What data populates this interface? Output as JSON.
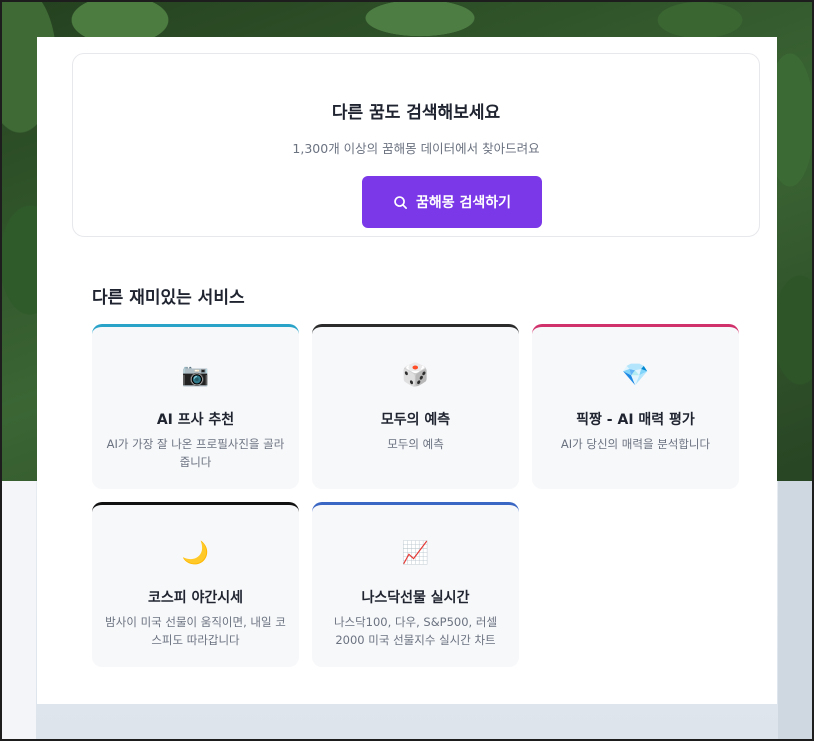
{
  "search_section": {
    "title": "다른 꿈도 검색해보세요",
    "subtitle": "1,300개 이상의 꿈해몽 데이터에서 찾아드려요",
    "button_label": "꿈해몽 검색하기",
    "button_color": "#7a38e8"
  },
  "services_section": {
    "title": "다른 재미있는 서비스",
    "cards": [
      {
        "icon": "📷",
        "icon_name": "camera-icon",
        "title": "AI 프사 추천",
        "desc": "AI가 가장 잘 나온 프로필사진을 골라줍니다",
        "accent": "#2aa3c9"
      },
      {
        "icon": "🎲",
        "icon_name": "dice-icon",
        "title": "모두의 예측",
        "desc": "모두의 예측",
        "accent": "#2b2b2b"
      },
      {
        "icon": "💎",
        "icon_name": "gem-icon",
        "title": "픽짱 - AI 매력 평가",
        "desc": "AI가 당신의 매력을 분석합니다",
        "accent": "#d0316b"
      },
      {
        "icon": "🌙",
        "icon_name": "moon-icon",
        "title": "코스피 야간시세",
        "desc": "밤사이 미국 선물이 움직이면, 내일 코스피도 따라갑니다",
        "accent": "#111111"
      },
      {
        "icon": "📈",
        "icon_name": "chart-up-icon",
        "title": "나스닥선물 실시간",
        "desc": "나스닥100, 다우, S&P500, 러셀 2000 미국 선물지수 실시간 차트",
        "accent": "#3a66c4"
      }
    ]
  }
}
